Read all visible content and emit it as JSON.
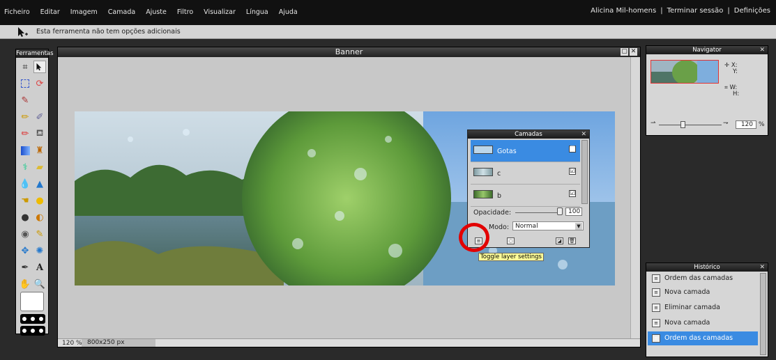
{
  "menu": {
    "items": [
      "Ficheiro",
      "Editar",
      "Imagem",
      "Camada",
      "Ajuste",
      "Filtro",
      "Visualizar",
      "Língua",
      "Ajuda"
    ],
    "user": "Alicina Mil-homens",
    "sep1": "|",
    "logout": "Terminar sessão",
    "sep2": "|",
    "settings": "Definições"
  },
  "options_bar": {
    "message": "Esta ferramenta não tem opções adicionais"
  },
  "tools": {
    "title": "Ferramentas"
  },
  "document": {
    "title": "Banner",
    "zoom": "120 %",
    "size": "800x250 px"
  },
  "layers": {
    "title": "Camadas",
    "items": [
      {
        "name": "Gotas",
        "checked": "☑"
      },
      {
        "name": "c",
        "checked": "☑"
      },
      {
        "name": "b",
        "checked": "☑"
      }
    ],
    "opacity_label": "Opacidade:",
    "opacity_value": "100",
    "mode_label": "Modo:",
    "mode_value": "Normal"
  },
  "tooltip": "Toggle layer settings",
  "navigator": {
    "title": "Navigator",
    "x_label": "X:",
    "y_label": "Y:",
    "w_label": "W:",
    "h_label": "H:",
    "zoom_value": "120",
    "zoom_unit": "%"
  },
  "history": {
    "title": "Histórico",
    "items": [
      "Ordem das camadas",
      "Nova camada",
      "Eliminar camada",
      "Nova camada",
      "Ordem das camadas"
    ]
  },
  "colors": {
    "selection": "#3a8be2",
    "highlight_ring": "#e20000"
  }
}
